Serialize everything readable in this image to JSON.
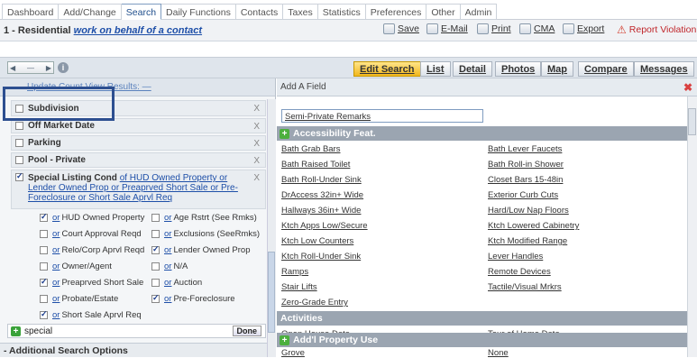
{
  "tabs": [
    "Dashboard",
    "Add/Change",
    "Search",
    "Daily Functions",
    "Contacts",
    "Taxes",
    "Statistics",
    "Preferences",
    "Other",
    "Admin"
  ],
  "active_tab": "Search",
  "title": {
    "prefix": "1 - Residential ",
    "link": "work on behalf of a contact"
  },
  "toolbar": {
    "save": "Save",
    "email": "E-Mail",
    "print": "Print",
    "cma": "CMA",
    "export": "Export",
    "report": "Report Violation"
  },
  "views": [
    "Edit Search",
    "List",
    "Detail",
    "Photos",
    "Map",
    "Compare",
    "Messages"
  ],
  "left_header": "Update Count   View Results: —",
  "filters": [
    {
      "label": "Subdivision"
    },
    {
      "label": "Off Market Date"
    },
    {
      "label": "Parking"
    },
    {
      "label": "Pool - Private"
    }
  ],
  "slc": {
    "label": "Special Listing Cond",
    "desc": "of HUD Owned Property or Lender Owned Prop or Preaprved Short Sale or Pre-Foreclosure or Short Sale Aprvl Req"
  },
  "options": [
    {
      "text": "HUD Owned Property",
      "checked": true
    },
    {
      "text": "Age Rstrt (See Rmks)",
      "checked": false
    },
    {
      "text": "Court Approval Reqd",
      "checked": false
    },
    {
      "text": "Exclusions (SeeRmks)",
      "checked": false
    },
    {
      "text": "Relo/Corp Aprvl Reqd",
      "checked": false
    },
    {
      "text": "Lender Owned Prop",
      "checked": true
    },
    {
      "text": "Owner/Agent",
      "checked": false
    },
    {
      "text": "N/A",
      "checked": false
    },
    {
      "text": "Preaprved Short Sale",
      "checked": true
    },
    {
      "text": "Auction",
      "checked": false
    },
    {
      "text": "Probate/Estate",
      "checked": false
    },
    {
      "text": "Pre-Foreclosure",
      "checked": true
    },
    {
      "text": "Short Sale Aprvl Req",
      "checked": true
    }
  ],
  "or_word": "or",
  "search_value": "special",
  "done_label": "Done",
  "additional": "- Additional Search Options",
  "right_header": "Add A Field",
  "field_input": "Semi-Private Remarks",
  "categories": [
    {
      "name": "Accessibility Feat.",
      "plus": true
    },
    {
      "name": "Activities",
      "plus": false
    },
    {
      "name": "Add'l Property Use",
      "plus": true
    }
  ],
  "fields_col1": [
    "Bath Grab Bars",
    "Bath Raised Toilet",
    "Bath Roll-Under Sink",
    "DrAccess 32in+ Wide",
    "Hallways 36in+ Wide",
    "Ktch Apps Low/Secure",
    "Ktch Low Counters",
    "Ktch Roll-Under Sink",
    "Ramps",
    "Stair Lifts",
    "Zero-Grade Entry"
  ],
  "fields_col2": [
    "Bath Lever Faucets",
    "Bath Roll-in Shower",
    "Closet Bars 15-48in",
    "Exterior Curb Cuts",
    "Hard/Low Nap Floors",
    "Ktch Lowered Cabinetry",
    "Ktch Modified Range",
    "Lever Handles",
    "Remote Devices",
    "Tactile/Visual Mrkrs"
  ],
  "activities": [
    "Open House Date",
    "Tour of Home Date"
  ],
  "addl_use": [
    "Grove",
    "None"
  ],
  "x_mark": "X",
  "close_mark": "✖"
}
